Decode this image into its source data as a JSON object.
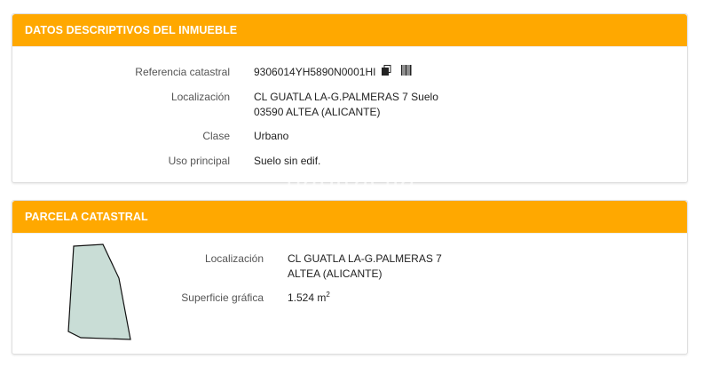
{
  "descriptive": {
    "header": "DATOS DESCRIPTIVOS DEL INMUEBLE",
    "rows": [
      {
        "label": "Referencia catastral",
        "value": "9306014YH5890N0001HI"
      },
      {
        "label": "Localización",
        "value": "CL GUATLA LA-G.PALMERAS 7 Suelo",
        "value2": "03590 ALTEA (ALICANTE)"
      },
      {
        "label": "Clase",
        "value": "Urbano"
      },
      {
        "label": "Uso principal",
        "value": "Suelo sin edif."
      }
    ],
    "icons": [
      "copy-icon",
      "barcode-icon"
    ]
  },
  "parcel": {
    "header": "PARCELA CATASTRAL",
    "rows": [
      {
        "label": "Localización",
        "value": "CL GUATLA LA-G.PALMERAS 7",
        "value2": "ALTEA (ALICANTE)"
      },
      {
        "label": "Superficie gráfica",
        "value": "1.524 m",
        "unit_sup": "2"
      }
    ],
    "shape_fill": "#c9ddd6"
  },
  "watermark": "habitaclia",
  "colors": {
    "header_bg": "#ffa800",
    "header_text": "#ffffff"
  }
}
